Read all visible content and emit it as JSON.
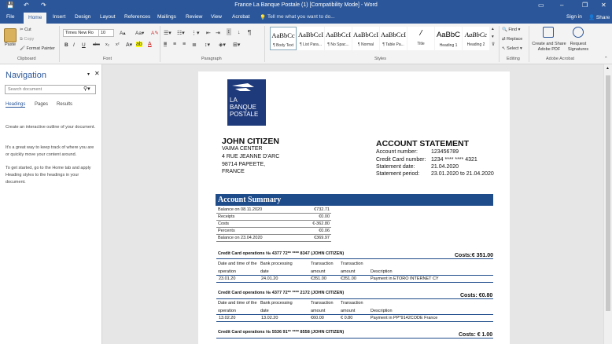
{
  "titlebar": {
    "title": "France La Banque Postale (1) [Compatibility Mode] - Word",
    "save_icon": "save-icon",
    "undo_icon": "undo-icon",
    "redo_icon": "redo-icon",
    "window_controls": [
      "minimize-icon",
      "restore-icon",
      "close-icon"
    ]
  },
  "tabs": {
    "items": [
      "File",
      "Home",
      "Insert",
      "Design",
      "Layout",
      "References",
      "Mailings",
      "Review",
      "View",
      "Acrobat"
    ],
    "active": "Home",
    "tellme": "Tell me what you want to do...",
    "signin": "Sign in",
    "share": "Share"
  },
  "ribbon": {
    "clipboard": {
      "paste": "Paste",
      "cut": "Cut",
      "copy": "Copy",
      "format_painter": "Format Painter",
      "label": "Clipboard"
    },
    "font": {
      "family": "Times New Ro",
      "size": "10",
      "label": "Font",
      "buttons": [
        "B",
        "I",
        "U",
        "abc",
        "x₂",
        "x²"
      ]
    },
    "paragraph": {
      "label": "Paragraph"
    },
    "styles": {
      "label": "Styles",
      "items": [
        {
          "sample": "AaBbCc",
          "name": "¶ Body Text"
        },
        {
          "sample": "AaBbCcI",
          "name": "¶ List Para..."
        },
        {
          "sample": "AaBbCcI",
          "name": "¶ No Spac..."
        },
        {
          "sample": "AaBbCcI",
          "name": "¶ Normal"
        },
        {
          "sample": "AaBbCcI",
          "name": "¶ Table Pa..."
        },
        {
          "sample": "AaBbC",
          "name": "Title"
        },
        {
          "sample": "AaBbC",
          "name": "Heading 1"
        },
        {
          "sample": "AaBbCc",
          "name": "Heading 2"
        }
      ]
    },
    "editing": {
      "label": "Editing",
      "find": "Find",
      "replace": "Replace",
      "select": "Select"
    },
    "acrobat": {
      "label": "Adobe Acrobat",
      "create_share": "Create and Share Adobe PDF",
      "request": "Request Signatures"
    }
  },
  "nav": {
    "title": "Navigation",
    "search_placeholder": "Search document",
    "tabs": [
      "Headings",
      "Pages",
      "Results"
    ],
    "p1": "Create an interactive outline of your document.",
    "p2": "It's a great way to keep track of where you are or quickly move your content around.",
    "p3": "To get started, go to the Home tab and apply Heading styles to the headings in your document."
  },
  "doc": {
    "logo": [
      "LA",
      "BANQUE",
      "POSTALE"
    ],
    "customer": {
      "name": "JOHN CITIZEN",
      "lines": [
        "VAIMA CENTER",
        "4 RUE JEANNE D'ARC",
        "98714 PAPEETE,",
        "FRANCE"
      ]
    },
    "statement": {
      "title": "ACCOUNT STATEMENT",
      "rows": [
        {
          "label": "Account number:",
          "value": "123456789"
        },
        {
          "label": "Credit Card number:",
          "value": "1234 **** **** 4321"
        },
        {
          "label": "Statement date:",
          "value": "21.04.2020"
        },
        {
          "label": "Statement period:",
          "value": "23.01.2020 to 21.04.2020"
        }
      ]
    },
    "summary": {
      "title": "Account Summary",
      "rows": [
        {
          "label": "Balance on  08.11.2020",
          "value": "€732.71"
        },
        {
          "label": "Receipts",
          "value": "€0.00"
        },
        {
          "label": "Costs",
          "value": "€-362.80"
        },
        {
          "label": "Percents",
          "value": "€0.06"
        },
        {
          "label": "Balance on  23.04.2020",
          "value": "€369.97"
        }
      ]
    },
    "headers": [
      "Date and time of the operation",
      "Bank processing date",
      "Transaction amount",
      "Transaction amount",
      "Description"
    ],
    "ops": [
      {
        "title": "Credit Card operations № 4377 72** **** 8347 (JOHN CITIZEN)",
        "costs": "Costs:€ 351.00",
        "row": [
          "23.01.20",
          "24.01.20",
          "€351.00",
          "€351.00",
          "Payment in ETORO INTERNET CY"
        ]
      },
      {
        "title": "Credit Card operations № 4377 72** **** 2172 (JOHN CITIZEN)",
        "costs": "Costs: €0.80",
        "row": [
          "13.02.20",
          "13.02.20",
          "€60.00",
          "€ 0.80",
          "Payment in PP*9142CODE France"
        ]
      },
      {
        "title": "Credit Card operations № 5536 91** **** 8558 (JOHN CITIZEN)",
        "costs": "Costs: € 1.00"
      }
    ]
  }
}
